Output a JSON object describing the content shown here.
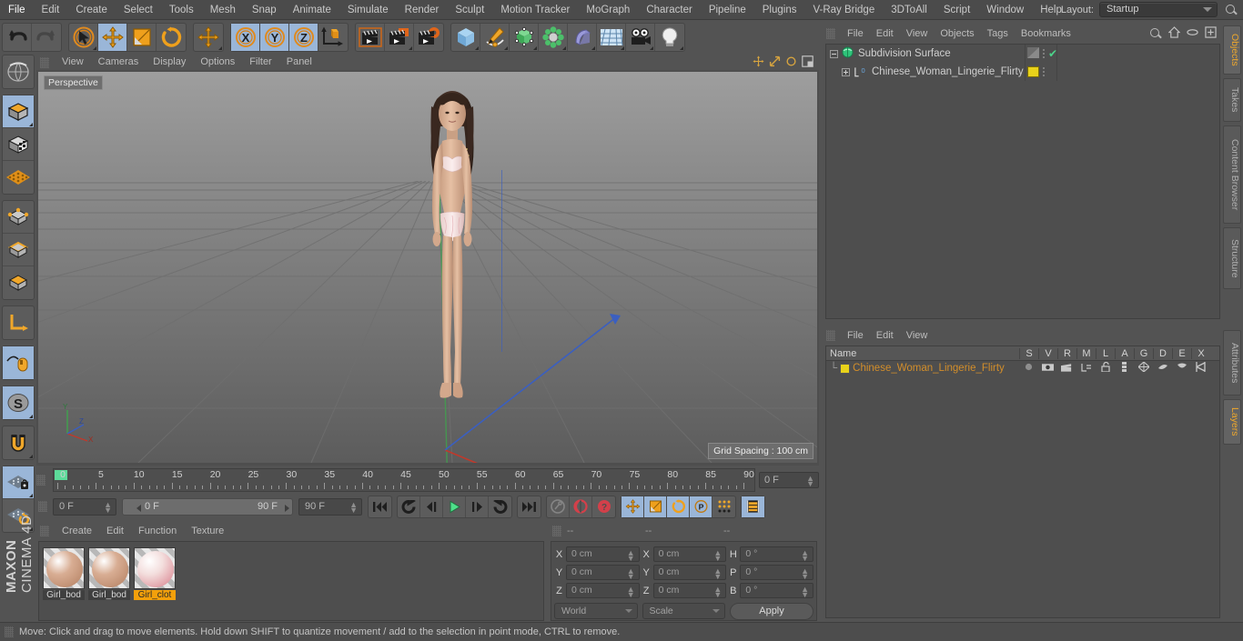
{
  "app": {
    "name": "MAXON CINEMA 4D",
    "brand_bold": "MAXON",
    "brand_light": "CINEMA 4D"
  },
  "menubar": {
    "items": [
      "File",
      "Edit",
      "Create",
      "Select",
      "Tools",
      "Mesh",
      "Snap",
      "Animate",
      "Simulate",
      "Render",
      "Sculpt",
      "Motion Tracker",
      "MoGraph",
      "Character",
      "Pipeline",
      "Plugins",
      "V-Ray Bridge",
      "3DToAll",
      "Script",
      "Window",
      "Help"
    ],
    "layout_label": "Layout:",
    "layout_value": "Startup",
    "search_icon": "search-icon"
  },
  "main_toolbar": {
    "groups": [
      {
        "name": "history",
        "buttons": [
          {
            "name": "undo-icon",
            "selected": false
          },
          {
            "name": "redo-icon",
            "selected": false
          }
        ]
      },
      {
        "name": "modes",
        "buttons": [
          {
            "name": "select-live-icon",
            "selected": false
          },
          {
            "name": "move-icon",
            "selected": true
          },
          {
            "name": "scale-icon",
            "selected": false
          },
          {
            "name": "rotate-icon",
            "selected": false
          }
        ]
      },
      {
        "name": "move-dup",
        "buttons": [
          {
            "name": "move-icon",
            "selected": false
          }
        ]
      },
      {
        "name": "axis-locks",
        "buttons": [
          {
            "name": "lock-x-icon",
            "selected": true,
            "label": "X"
          },
          {
            "name": "lock-y-icon",
            "selected": true,
            "label": "Y"
          },
          {
            "name": "lock-z-icon",
            "selected": true,
            "label": "Z"
          },
          {
            "name": "world-object-axis-icon",
            "selected": false
          }
        ]
      },
      {
        "name": "render",
        "buttons": [
          {
            "name": "render-view-icon",
            "selected": false
          },
          {
            "name": "render-region-icon",
            "selected": false
          },
          {
            "name": "render-settings-icon",
            "selected": false
          }
        ]
      },
      {
        "name": "create",
        "buttons": [
          {
            "name": "cube-primitive-icon",
            "selected": false
          },
          {
            "name": "spline-pen-icon",
            "selected": false
          },
          {
            "name": "generator-icon",
            "selected": false
          },
          {
            "name": "deformer-icon",
            "selected": false
          },
          {
            "name": "scene-object-icon",
            "selected": false
          },
          {
            "name": "floor-icon",
            "selected": false
          },
          {
            "name": "camera-icon",
            "selected": false
          },
          {
            "name": "light-icon",
            "selected": false
          }
        ]
      }
    ]
  },
  "left_toolbar": {
    "groups": [
      {
        "buttons": [
          {
            "name": "undo-view-icon",
            "selected": false
          }
        ]
      },
      {
        "buttons": [
          {
            "name": "model-mode-icon",
            "selected": true
          },
          {
            "name": "texture-mode-icon",
            "selected": false
          },
          {
            "name": "polygon-select-icon",
            "selected": false
          }
        ]
      },
      {
        "buttons": [
          {
            "name": "points-mode-icon",
            "selected": false
          },
          {
            "name": "edges-mode-icon",
            "selected": false
          },
          {
            "name": "polygons-mode-icon",
            "selected": false
          }
        ]
      },
      {
        "buttons": [
          {
            "name": "axis-mode-icon",
            "selected": false
          }
        ]
      },
      {
        "buttons": [
          {
            "name": "viewport-solo-icon",
            "selected": true
          }
        ]
      },
      {
        "buttons": [
          {
            "name": "snap-enable-icon",
            "selected": true
          }
        ]
      },
      {
        "buttons": [
          {
            "name": "magnet-icon",
            "selected": false
          }
        ]
      },
      {
        "buttons": [
          {
            "name": "workplane-lock-icon",
            "selected": true
          },
          {
            "name": "workplane-rotate-icon",
            "selected": false
          }
        ]
      }
    ]
  },
  "viewport": {
    "menu": [
      "View",
      "Cameras",
      "Display",
      "Options",
      "Filter",
      "Panel"
    ],
    "label": "Perspective",
    "grid_spacing": "Grid Spacing : 100 cm",
    "axis_labels": {
      "x": "X",
      "y": "Y",
      "z": "Z"
    }
  },
  "timeline": {
    "ticks": [
      0,
      5,
      10,
      15,
      20,
      25,
      30,
      35,
      40,
      45,
      50,
      55,
      60,
      65,
      70,
      75,
      80,
      85,
      90
    ],
    "current_frame_field": "0 F",
    "start_field": "0 F",
    "range_start": "0 F",
    "range_end": "90 F",
    "end_field": "90 F",
    "transport_buttons": [
      {
        "name": "go-to-start-icon",
        "selected": false
      },
      {
        "name": "play-backwards-loop-icon",
        "selected": false
      },
      {
        "name": "previous-frame-icon",
        "selected": false
      },
      {
        "name": "play-icon",
        "selected": false
      },
      {
        "name": "next-frame-icon",
        "selected": false
      },
      {
        "name": "play-forwards-loop-icon",
        "selected": false
      },
      {
        "name": "go-to-end-icon",
        "selected": false
      },
      {
        "name": "record-active-objects-icon",
        "selected": false
      },
      {
        "name": "autokeying-icon",
        "selected": false
      },
      {
        "name": "keyframe-selection-icon",
        "selected": false
      },
      {
        "name": "record-position-icon",
        "selected": true
      },
      {
        "name": "record-scale-icon",
        "selected": true
      },
      {
        "name": "record-rotation-icon",
        "selected": true
      },
      {
        "name": "record-parameter-icon",
        "selected": true
      },
      {
        "name": "point-level-animation-icon",
        "selected": false
      },
      {
        "name": "timeline-icon",
        "selected": true
      }
    ]
  },
  "material_manager": {
    "menu": [
      "Create",
      "Edit",
      "Function",
      "Texture"
    ],
    "materials": [
      {
        "name": "Girl_body",
        "selected": false,
        "color": "#d8ad93",
        "accent": "#c08f72"
      },
      {
        "name": "Girl_body",
        "selected": false,
        "color": "#d8ad93",
        "accent": "#c08f72"
      },
      {
        "name": "Girl_cloth",
        "selected": true,
        "color": "#f3dedd",
        "accent": "#e2a0a8"
      }
    ],
    "labels": [
      "Girl_bod",
      "Girl_bod",
      "Girl_clot"
    ]
  },
  "coordinates": {
    "headers": [
      "--",
      "--",
      "--"
    ],
    "rows": [
      {
        "label_pos": "X",
        "value_pos": "0 cm",
        "label_size": "X",
        "value_size": "0 cm",
        "label_rot": "H",
        "value_rot": "0 °"
      },
      {
        "label_pos": "Y",
        "value_pos": "0 cm",
        "label_size": "Y",
        "value_size": "0 cm",
        "label_rot": "P",
        "value_rot": "0 °"
      },
      {
        "label_pos": "Z",
        "value_pos": "0 cm",
        "label_size": "Z",
        "value_size": "0 cm",
        "label_rot": "B",
        "value_rot": "0 °"
      }
    ],
    "system_dropdown": "World",
    "mode_dropdown": "Scale",
    "apply_label": "Apply"
  },
  "object_manager": {
    "menu": [
      "File",
      "Edit",
      "View",
      "Objects",
      "Tags",
      "Bookmarks"
    ],
    "header_icons": [
      "search-icon",
      "home-icon",
      "ellipse-icon",
      "new-layer-icon"
    ],
    "rows": [
      {
        "name": "Subdivision Surface",
        "indent": 0,
        "icon": "subdivision-surface-icon",
        "tag_color": "#7a7a7a",
        "check": "✔"
      },
      {
        "name": "Chinese_Woman_Lingerie_Flirty",
        "indent": 1,
        "icon": "null-object-icon",
        "tag_color": "#e8d21a",
        "check": ""
      }
    ]
  },
  "layer_manager": {
    "menu": [
      "File",
      "Edit",
      "View"
    ],
    "columns": [
      "Name",
      "S",
      "V",
      "R",
      "M",
      "L",
      "A",
      "G",
      "D",
      "E",
      "X"
    ],
    "rows": [
      {
        "name": "Chinese_Woman_Lingerie_Flirty",
        "color": "#e8d21a"
      }
    ]
  },
  "right_tabs": {
    "top": [
      {
        "label": "Objects",
        "active": true
      },
      {
        "label": "Takes",
        "active": false
      },
      {
        "label": "Content Browser",
        "active": false
      },
      {
        "label": "Structure",
        "active": false
      }
    ],
    "bottom": [
      {
        "label": "Attributes",
        "active": false
      },
      {
        "label": "Layers",
        "active": true
      }
    ]
  },
  "status_bar": {
    "message": "Move: Click and drag to move elements. Hold down SHIFT to quantize movement / add to the selection in point mode, CTRL to remove."
  },
  "colors": {
    "window_bg": "#535353",
    "panel_bg": "#4e4e4e",
    "selected_tool": "#9ab6d8",
    "accent_orange": "#f3a00b",
    "layer_yellow": "#e8d21a",
    "axis_x": "#c0392b",
    "axis_y": "#3fa34d",
    "axis_z": "#3b5fc0",
    "playhead_green": "#5ddb9a"
  }
}
